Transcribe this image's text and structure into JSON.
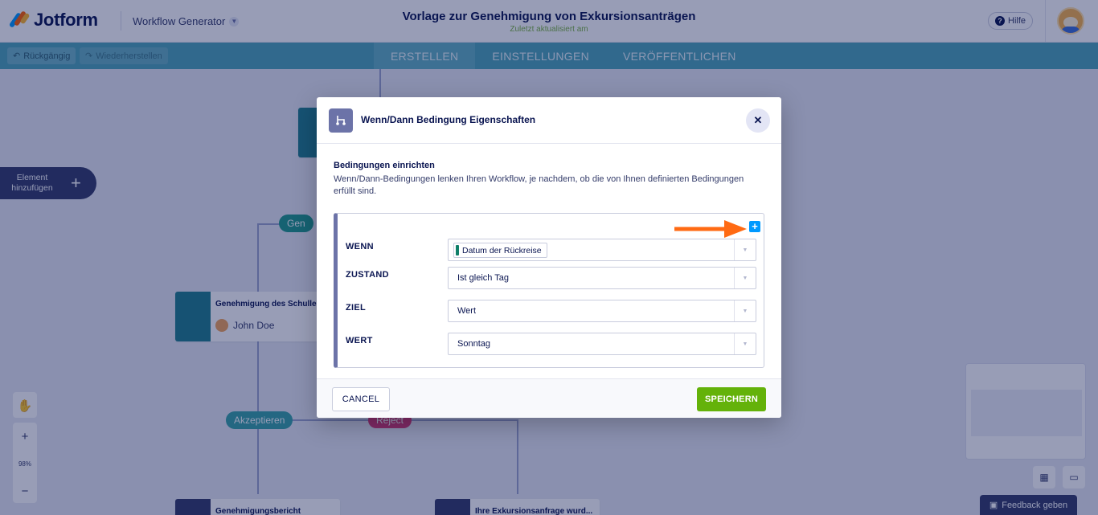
{
  "header": {
    "brand": "Jotform",
    "product_menu": "Workflow Generator",
    "title": "Vorlage zur Genehmigung von Exkursionsanträgen",
    "subtitle": "Zuletzt aktualisiert am",
    "help": "Hilfe"
  },
  "toolbar": {
    "undo": "Rückgängig",
    "redo": "Wiederherstellen",
    "tabs": [
      "ERSTELLEN",
      "EINSTELLUNGEN",
      "VERÖFFENTLICHEN"
    ],
    "active_tab": "ERSTELLEN"
  },
  "canvas": {
    "add_element": "Element hinzufügen",
    "nodes": [
      {
        "title": "Genehmigung des Schulle",
        "user": "John Doe"
      },
      {
        "title": "Genehmigungsbericht"
      },
      {
        "title": "Ihre Exkursionsanfrage wurd..."
      }
    ],
    "branches": {
      "gen": "Gen",
      "accept": "Akzeptieren",
      "reject": "Reject"
    },
    "zoom_level": "98%",
    "feedback": "Feedback geben"
  },
  "modal": {
    "title": "Wenn/Dann Bedingung Eigenschaften",
    "section_title": "Bedingungen einrichten",
    "section_desc": "Wenn/Dann-Bedingungen lenken Ihren Workflow, je nachdem, ob die von Ihnen definierten Bedingungen erfüllt sind.",
    "rows": [
      {
        "label": "WENN",
        "value": "Datum der Rückreise"
      },
      {
        "label": "ZUSTAND",
        "value": "Ist gleich Tag"
      },
      {
        "label": "ZIEL",
        "value": "Wert"
      },
      {
        "label": "WERT",
        "value": "Sonntag"
      }
    ],
    "cancel": "CANCEL",
    "save": "SPEICHERN"
  },
  "colors": {
    "accent_teal": "#4fa5b8",
    "save_green": "#64b20a",
    "add_blue": "#0099ff",
    "arrow_orange": "#ff6a13",
    "navy": "#0a1551"
  }
}
